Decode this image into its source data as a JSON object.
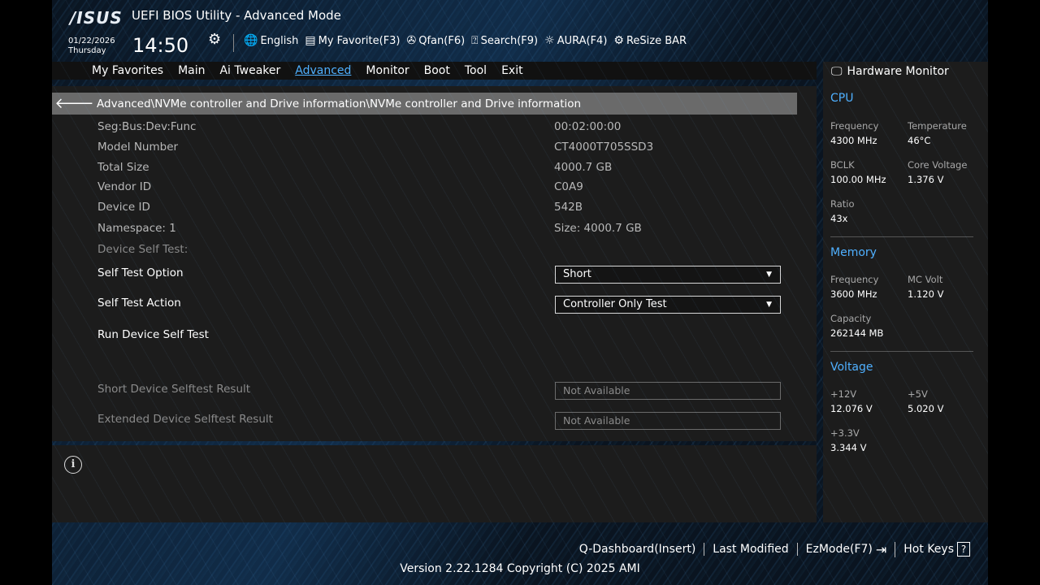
{
  "header": {
    "logo": "/ISUS",
    "title": "UEFI BIOS Utility - Advanced Mode",
    "date": "01/22/2026",
    "day": "Thursday",
    "time": "14:50"
  },
  "toolbar": [
    {
      "icon": "globe-icon",
      "label": "English"
    },
    {
      "icon": "favorite-icon",
      "label": "My Favorite(F3)"
    },
    {
      "icon": "fan-icon",
      "label": "Qfan(F6)"
    },
    {
      "icon": "search-icon",
      "label": "Search(F9)"
    },
    {
      "icon": "aura-icon",
      "label": "AURA(F4)"
    },
    {
      "icon": "resize-bar-icon",
      "label": "ReSize BAR"
    }
  ],
  "tabs": [
    "My Favorites",
    "Main",
    "Ai Tweaker",
    "Advanced",
    "Monitor",
    "Boot",
    "Tool",
    "Exit"
  ],
  "active_tab": "Advanced",
  "breadcrumb": "Advanced\\NVMe controller and Drive information\\NVMe controller and Drive information",
  "info": {
    "seg_label": "Seg:Bus:Dev:Func",
    "seg_value": "00:02:00:00",
    "model_label": "Model Number",
    "model_value": "CT4000T705SSD3",
    "size_label": "Total Size",
    "size_value": "4000.7 GB",
    "vendor_label": "Vendor ID",
    "vendor_value": "C0A9",
    "device_label": "Device ID",
    "device_value": "542B",
    "ns_label": "Namespace: 1",
    "ns_value": "Size: 4000.7 GB",
    "selftest_label": "Device Self Test:"
  },
  "settings": {
    "option_label": "Self Test Option",
    "option_value": "Short",
    "action_label": "Self Test Action",
    "action_value": "Controller Only Test",
    "run_label": "Run Device Self Test",
    "short_label": "Short Device Selftest Result",
    "short_value": "Not Available",
    "ext_label": "Extended Device Selftest Result",
    "ext_value": "Not Available"
  },
  "hw": {
    "title": "Hardware Monitor",
    "cpu": {
      "heading": "CPU",
      "freq_l": "Frequency",
      "freq_v": "4300 MHz",
      "temp_l": "Temperature",
      "temp_v": "46°C",
      "bclk_l": "BCLK",
      "bclk_v": "100.00 MHz",
      "cv_l": "Core Voltage",
      "cv_v": "1.376 V",
      "ratio_l": "Ratio",
      "ratio_v": "43x"
    },
    "mem": {
      "heading": "Memory",
      "freq_l": "Frequency",
      "freq_v": "3600 MHz",
      "mc_l": "MC Volt",
      "mc_v": "1.120 V",
      "cap_l": "Capacity",
      "cap_v": "262144 MB"
    },
    "volt": {
      "heading": "Voltage",
      "v12_l": "+12V",
      "v12_v": "12.076 V",
      "v5_l": "+5V",
      "v5_v": "5.020 V",
      "v33_l": "+3.3V",
      "v33_v": "3.344 V"
    }
  },
  "bottom": {
    "qdash": "Q-Dashboard(Insert)",
    "last": "Last Modified",
    "ez": "EzMode(F7)",
    "hot": "Hot Keys",
    "version": "Version 2.22.1284 Copyright (C) 2025 AMI"
  },
  "colors": {
    "accent": "#4fb0ff",
    "panel": "#1c1c1c",
    "path_bar": "#6a6a6a"
  }
}
